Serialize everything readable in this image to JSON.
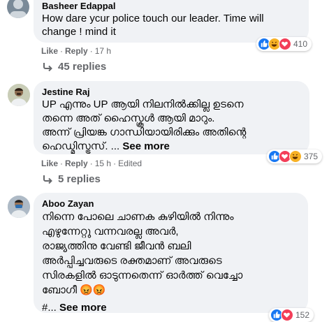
{
  "comments": [
    {
      "author": "Basheer Edappal",
      "text": "How dare ycur police touch our leader. Time will change ! mind it",
      "like": "Like",
      "reply": "Reply",
      "time": "17 h",
      "reaction_count": "410",
      "reactions": [
        "like-icon",
        "haha-icon",
        "love-icon"
      ],
      "replies": "45 replies"
    },
    {
      "author": "Jestine Raj",
      "text_lines": [
        "UP എന്നും UP ആയി നിലനിൽക്കില്ല ഉടനെ",
        "തന്നെ അത് ഹൈസ്കൂൾ ആയി മാറും.",
        "അന്ന് പ്രിയങ്ക ഗാന്ധിയായിരിക്കും അതിന്റെ",
        "ഹെഡ്മിസ്ട്രസ്. ..."
      ],
      "see_more": "See more",
      "like": "Like",
      "reply": "Reply",
      "time": "15 h",
      "edited": "Edited",
      "reaction_count": "375",
      "reactions": [
        "like-icon",
        "love-icon",
        "haha-icon"
      ],
      "replies": "5 replies"
    },
    {
      "author": "Aboo Zayan",
      "text_lines": [
        "നിന്നെ പോലെ ചാണക കുഴിയിൽ നിന്നും",
        "എഴുന്നേറ്റു വന്നവരല്ല അവർ,",
        "രാജ്യത്തിനു വേണ്ടി ജീവൻ ബലി",
        "അർപ്പിച്ചവരുടെ രക്തമാണ് അവരുടെ",
        "സിരകളിൽ ഓടുന്നതെന്ന് ഓർത്ത് വെച്ചോ",
        "ബോഗീ 😡😡"
      ],
      "hashtag": "#...",
      "see_more": "See more",
      "reaction_count": "152"
    }
  ],
  "colors": {
    "bubble": "#f0f2f5",
    "meta": "#65676b",
    "like_blue": "#1877f2",
    "love_red": "#f33e58",
    "haha_yellow": "#f7b125"
  }
}
